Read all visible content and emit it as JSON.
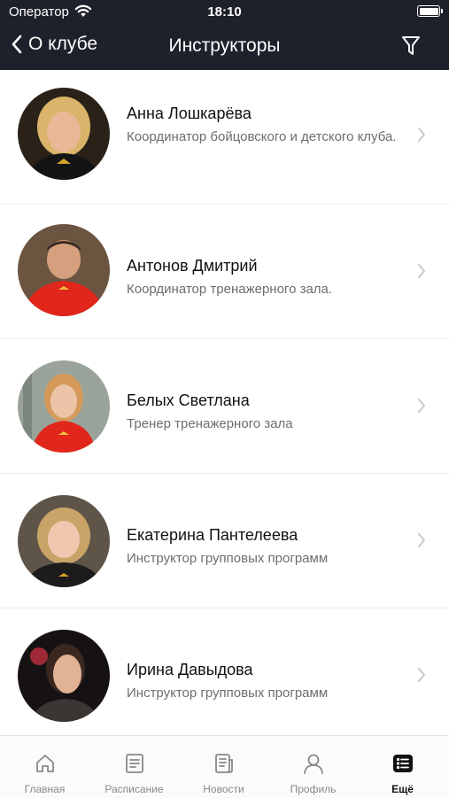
{
  "status_bar": {
    "carrier": "Оператор",
    "time": "18:10"
  },
  "nav": {
    "back_label": "О клубе",
    "title": "Инструкторы"
  },
  "instructors": [
    {
      "name": "Анна Лошкарёва",
      "role": "Координатор бойцовского и детского клуба.",
      "photo": "trainer-photo"
    },
    {
      "name": "Антонов Дмитрий",
      "role": "Координатор тренажерного зала.",
      "photo": "trainer-photo"
    },
    {
      "name": "Белых Светлана",
      "role": "Тренер тренажерного зала",
      "photo": "trainer-photo"
    },
    {
      "name": "Екатерина Пантелеева",
      "role": "Инструктор групповых программ",
      "photo": "trainer-photo"
    },
    {
      "name": "Ирина Давыдова",
      "role": "Инструктор групповых программ",
      "photo": "trainer-photo"
    }
  ],
  "tabs": [
    {
      "label": "Главная",
      "icon": "home-icon"
    },
    {
      "label": "Расписание",
      "icon": "schedule-icon"
    },
    {
      "label": "Новости",
      "icon": "news-icon"
    },
    {
      "label": "Профиль",
      "icon": "profile-icon"
    },
    {
      "label": "Ещё",
      "icon": "more-icon",
      "active": true
    }
  ],
  "colors": {
    "header_bg": "#1e212b",
    "accent_shirt": "#e1261c",
    "inactive_tab": "#888888"
  }
}
